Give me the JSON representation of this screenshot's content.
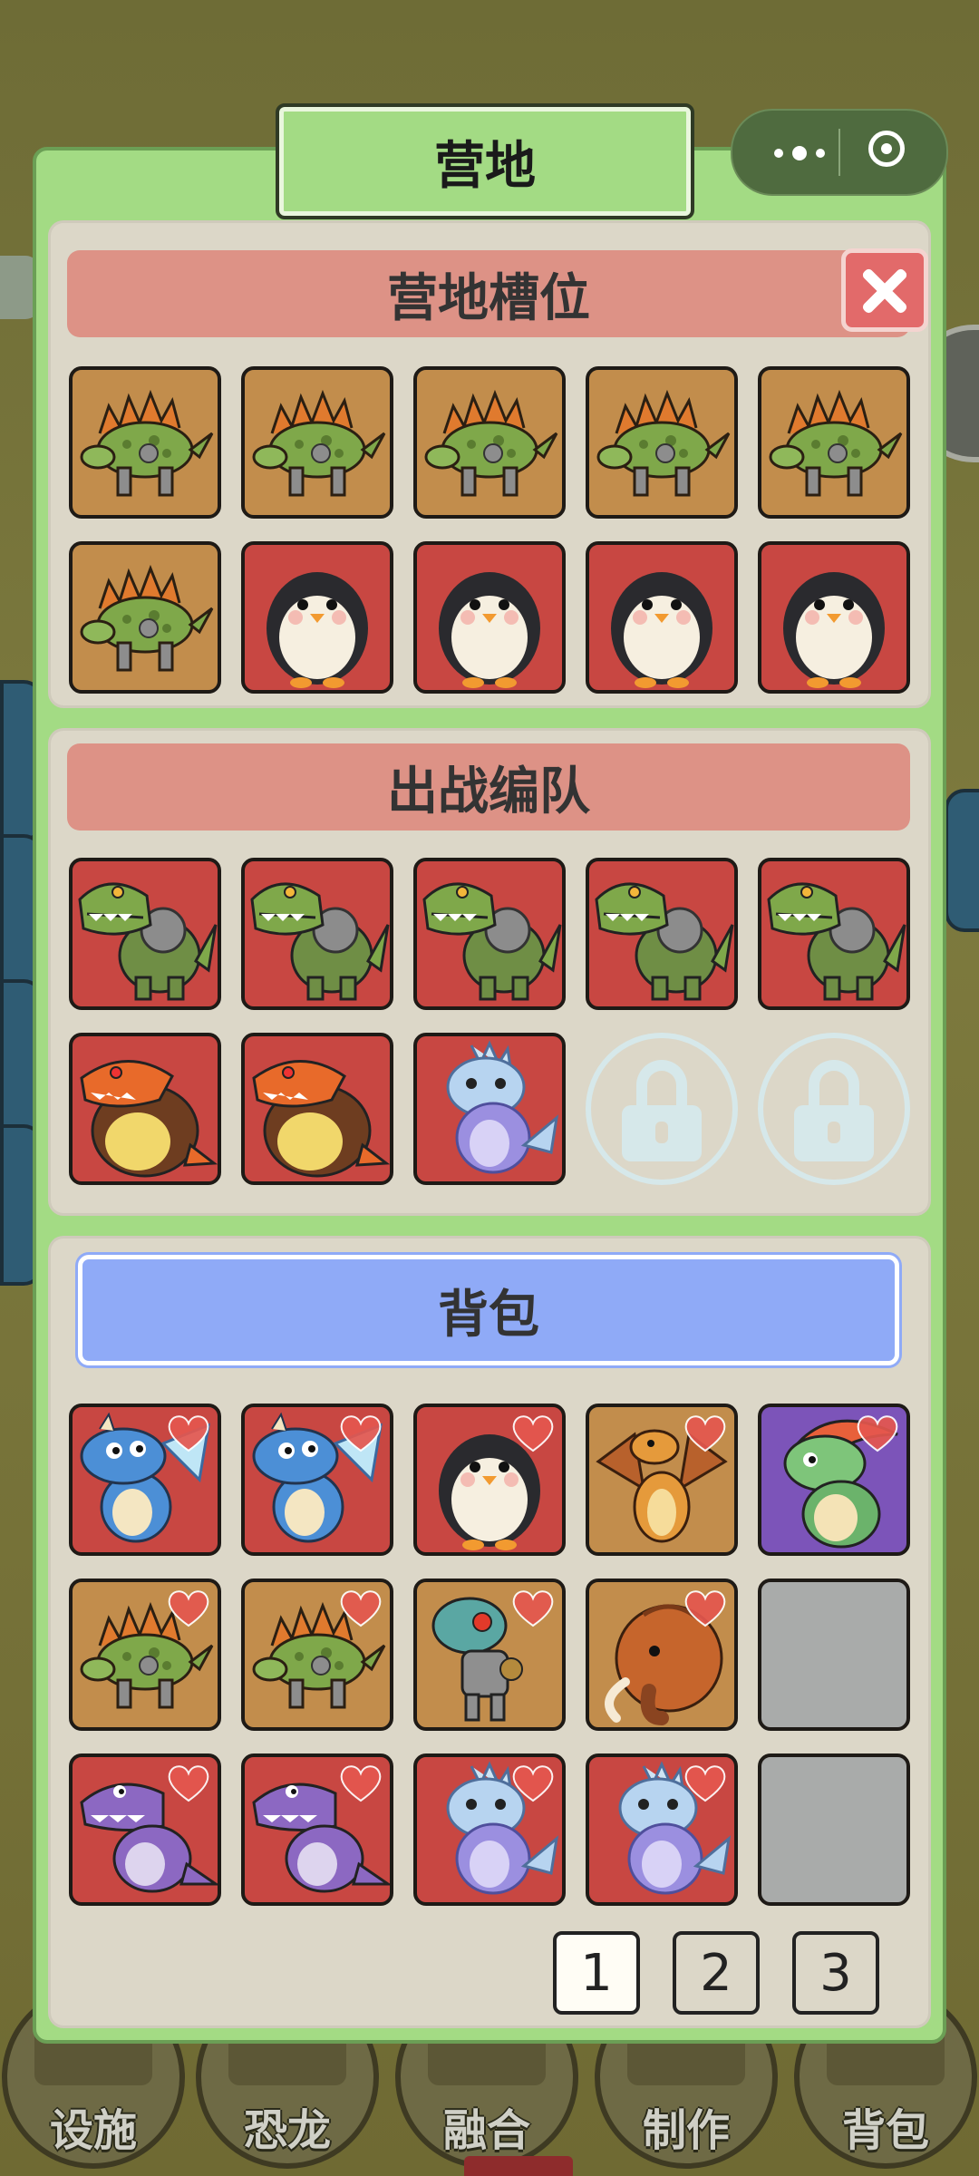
{
  "panel": {
    "title": "营地",
    "camp_slots_title": "营地槽位",
    "battle_team_title": "出战编队",
    "backpack_title": "背包"
  },
  "camp_slots": [
    {
      "creature": "stegosaurus-mech",
      "bg": "orange"
    },
    {
      "creature": "stegosaurus-mech",
      "bg": "orange"
    },
    {
      "creature": "stegosaurus-mech",
      "bg": "orange"
    },
    {
      "creature": "stegosaurus-mech",
      "bg": "orange"
    },
    {
      "creature": "stegosaurus-mech",
      "bg": "orange"
    },
    {
      "creature": "stegosaurus-mech",
      "bg": "orange"
    },
    {
      "creature": "penguin",
      "bg": "red"
    },
    {
      "creature": "penguin",
      "bg": "red"
    },
    {
      "creature": "penguin",
      "bg": "red"
    },
    {
      "creature": "penguin",
      "bg": "red"
    }
  ],
  "battle_team": [
    {
      "creature": "trex-mech",
      "bg": "red"
    },
    {
      "creature": "trex-mech",
      "bg": "red"
    },
    {
      "creature": "trex-mech",
      "bg": "red"
    },
    {
      "creature": "trex-mech",
      "bg": "red"
    },
    {
      "creature": "trex-mech",
      "bg": "red"
    },
    {
      "creature": "fire-dino",
      "bg": "red"
    },
    {
      "creature": "fire-dino",
      "bg": "red"
    },
    {
      "creature": "ice-dino",
      "bg": "red"
    },
    {
      "creature": "locked",
      "bg": "none"
    },
    {
      "creature": "locked",
      "bg": "none"
    }
  ],
  "backpack": [
    {
      "creature": "blue-dragon",
      "bg": "red",
      "heart": true
    },
    {
      "creature": "blue-dragon",
      "bg": "red",
      "heart": true
    },
    {
      "creature": "penguin",
      "bg": "red",
      "heart": true
    },
    {
      "creature": "orange-dragon",
      "bg": "orange",
      "heart": true
    },
    {
      "creature": "parasaurolophus",
      "bg": "purple",
      "heart": true
    },
    {
      "creature": "stegosaurus-mech",
      "bg": "orange",
      "heart": true
    },
    {
      "creature": "stegosaurus-mech",
      "bg": "orange",
      "heart": true
    },
    {
      "creature": "robot-dino",
      "bg": "orange",
      "heart": true
    },
    {
      "creature": "mammoth",
      "bg": "orange",
      "heart": true
    },
    {
      "creature": "empty",
      "bg": "empty",
      "heart": false
    },
    {
      "creature": "purple-trex",
      "bg": "red",
      "heart": true
    },
    {
      "creature": "purple-trex",
      "bg": "red",
      "heart": true
    },
    {
      "creature": "ice-dino",
      "bg": "red",
      "heart": true
    },
    {
      "creature": "ice-dino",
      "bg": "red",
      "heart": true
    },
    {
      "creature": "empty",
      "bg": "empty",
      "heart": false
    }
  ],
  "pagination": {
    "pages": [
      "1",
      "2",
      "3"
    ],
    "current": "1"
  },
  "bottom_nav": [
    "设施",
    "恐龙",
    "融合",
    "制作",
    "背包"
  ],
  "colors": {
    "panel_green": "#a3db84",
    "header_salmon": "#dd9286",
    "header_blue": "#8faaf7",
    "slot_orange": "#c28d4c",
    "slot_red": "#c84742",
    "slot_purple": "#7c54b9",
    "slot_empty": "#a9abaa",
    "heart": "#e4574f"
  }
}
